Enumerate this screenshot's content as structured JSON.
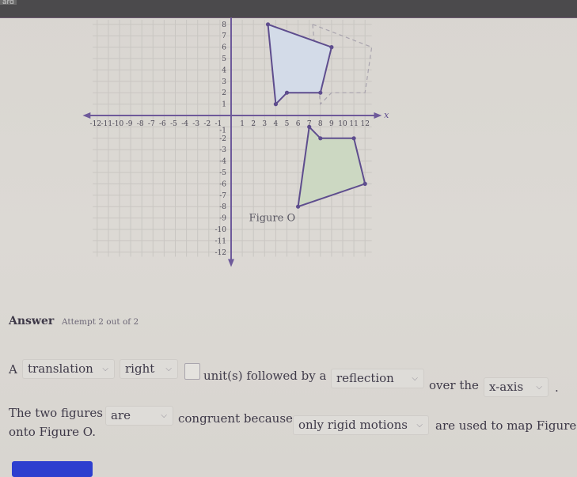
{
  "topbar": {
    "label": "ard"
  },
  "graph": {
    "x_axis_label": "x",
    "x_ticks": [
      "-12",
      "-11",
      "-10",
      "-9",
      "-8",
      "-7",
      "-6",
      "-5",
      "-4",
      "-3",
      "-2",
      "-1",
      "1",
      "2",
      "3",
      "4",
      "5",
      "6",
      "7",
      "8",
      "9",
      "10",
      "11",
      "12"
    ],
    "y_ticks": [
      "8",
      "7",
      "6",
      "5",
      "4",
      "3",
      "2",
      "1",
      "-1",
      "-2",
      "-3",
      "-4",
      "-5",
      "-6",
      "-7",
      "-8",
      "-9",
      "-10",
      "-11",
      "-12"
    ],
    "figure_label": "Figure O",
    "colors": {
      "axis": "#6e5a9a",
      "blue_fill": "#d3dbe8",
      "green_fill": "#ccd8c2",
      "edge": "#5e4d8e",
      "grid": "#c9c6c2",
      "dashed": "#a9a4ae"
    }
  },
  "chart_data": {
    "type": "scatter",
    "title": "",
    "xlabel": "x",
    "ylabel": "",
    "xlim": [
      -12,
      12
    ],
    "ylim": [
      -12,
      8
    ],
    "grid": true,
    "series": [
      {
        "name": "Original figure (blue)",
        "points": [
          [
            3.3,
            8
          ],
          [
            9,
            6
          ],
          [
            8,
            2
          ],
          [
            5,
            2
          ],
          [
            4,
            1
          ]
        ]
      },
      {
        "name": "Translated image (dashed)",
        "points": [
          [
            7.3,
            8
          ],
          [
            13,
            6
          ],
          [
            12,
            2
          ],
          [
            9,
            2
          ],
          [
            8,
            1
          ]
        ]
      },
      {
        "name": "Figure O (green)",
        "points": [
          [
            7,
            -1
          ],
          [
            8,
            -2
          ],
          [
            11,
            -2
          ],
          [
            12,
            -6
          ],
          [
            6,
            -8
          ]
        ]
      }
    ]
  },
  "answer": {
    "title": "Answer",
    "attempt": "Attempt 2 out of 2"
  },
  "line1": {
    "prefix": "A",
    "transformation1": "translation",
    "direction": "right",
    "units_value": "",
    "mid_text": "unit(s) followed by a",
    "transformation2": "reflection",
    "over_text": "over the",
    "axis": "x-axis",
    "end": "."
  },
  "line2": {
    "prefix": "The two figures",
    "are": "are",
    "mid_text": "congruent because",
    "reason": "only rigid motions",
    "suffix": "are used to map Figure",
    "line3": "onto Figure O."
  },
  "submit": {
    "label": ""
  }
}
